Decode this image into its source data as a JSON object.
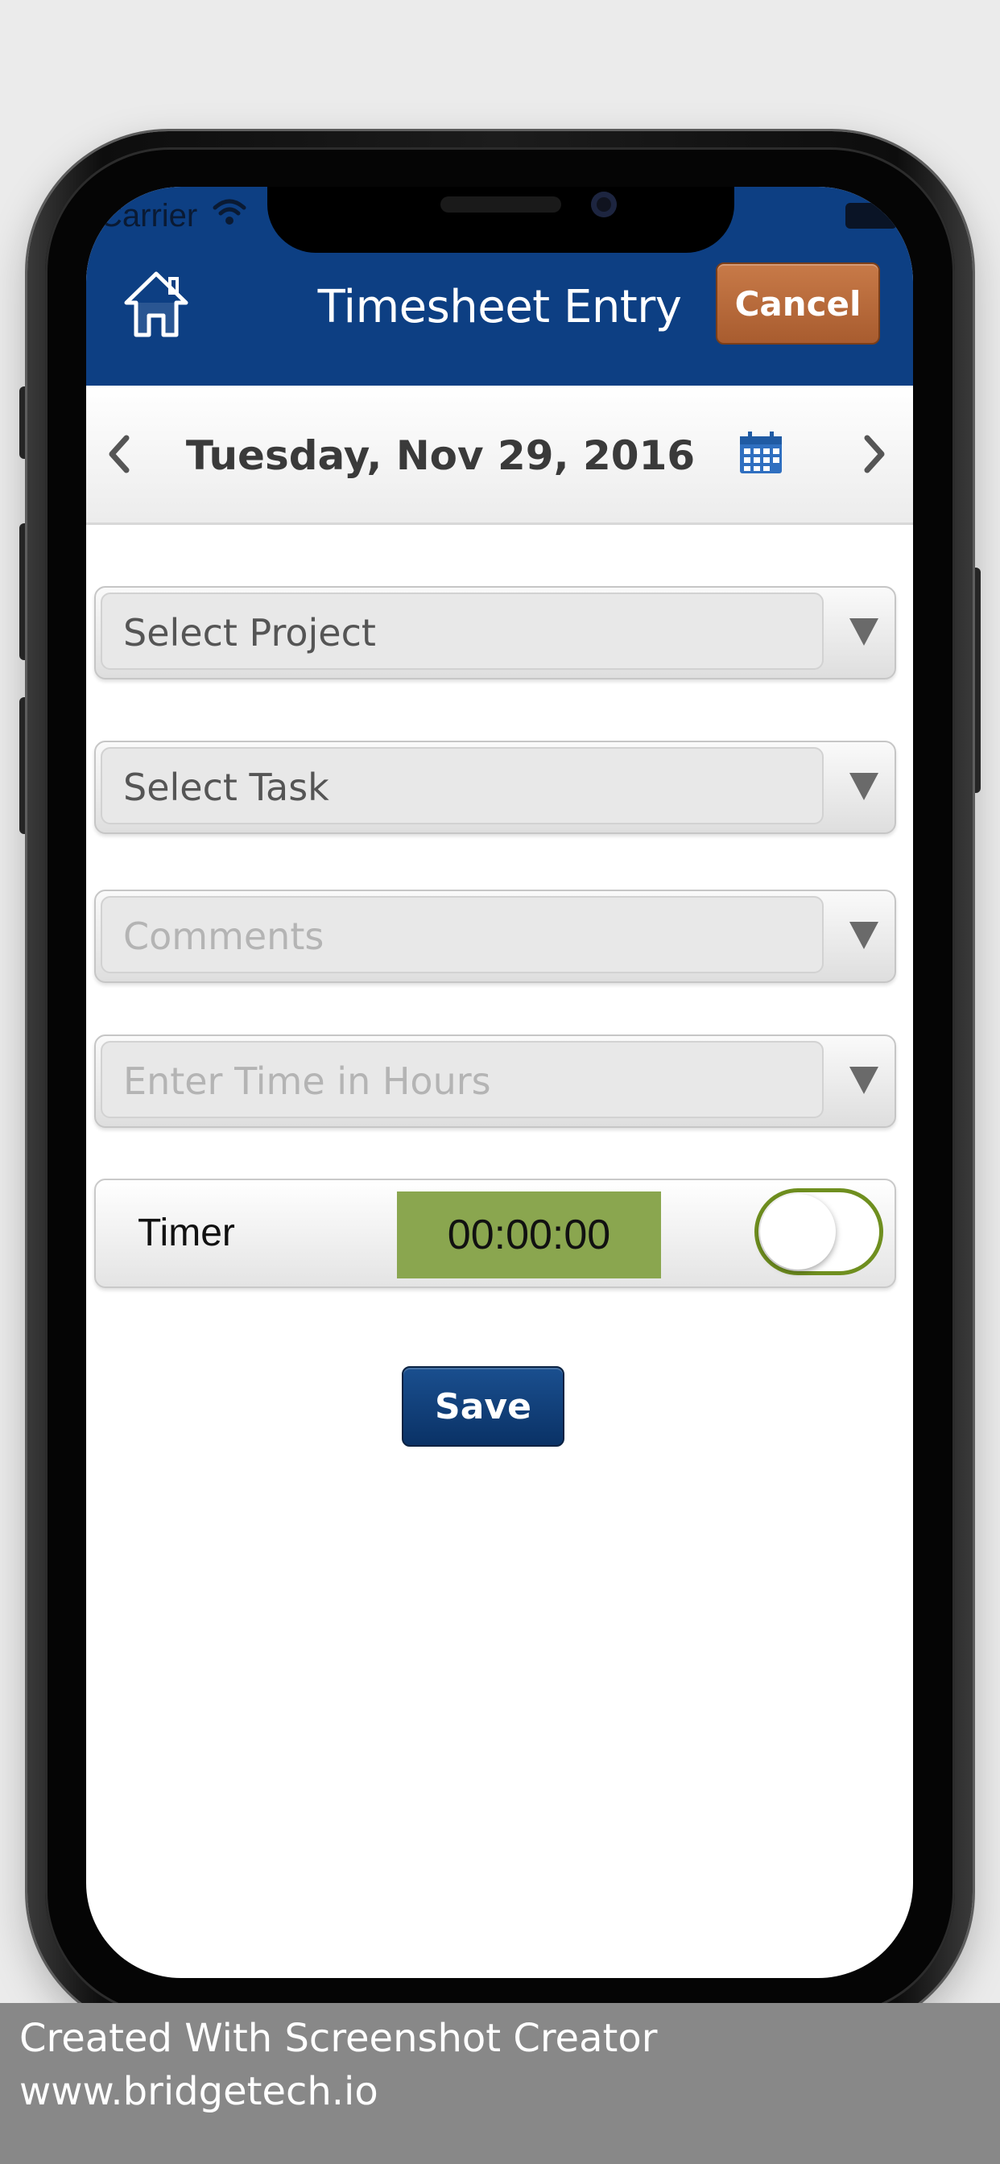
{
  "status_bar": {
    "carrier": "Carrier"
  },
  "nav": {
    "title": "Timesheet Entry",
    "cancel_label": "Cancel"
  },
  "date_bar": {
    "date": "Tuesday, Nov 29, 2016"
  },
  "form": {
    "project_placeholder": "Select Project",
    "task_placeholder": "Select Task",
    "comments_placeholder": "Comments",
    "hours_placeholder": "Enter Time in Hours",
    "timer_label": "Timer",
    "timer_value": "00:00:00",
    "timer_enabled": false,
    "save_label": "Save"
  },
  "colors": {
    "nav_blue": "#0d3f83",
    "cancel_orange": "#b8693a",
    "timer_green": "#8aa64f",
    "toggle_border": "#6f8f1f",
    "save_blue": "#0a3266"
  },
  "watermark": {
    "line1": "Created With Screenshot Creator",
    "line2": "www.bridgetech.io"
  }
}
